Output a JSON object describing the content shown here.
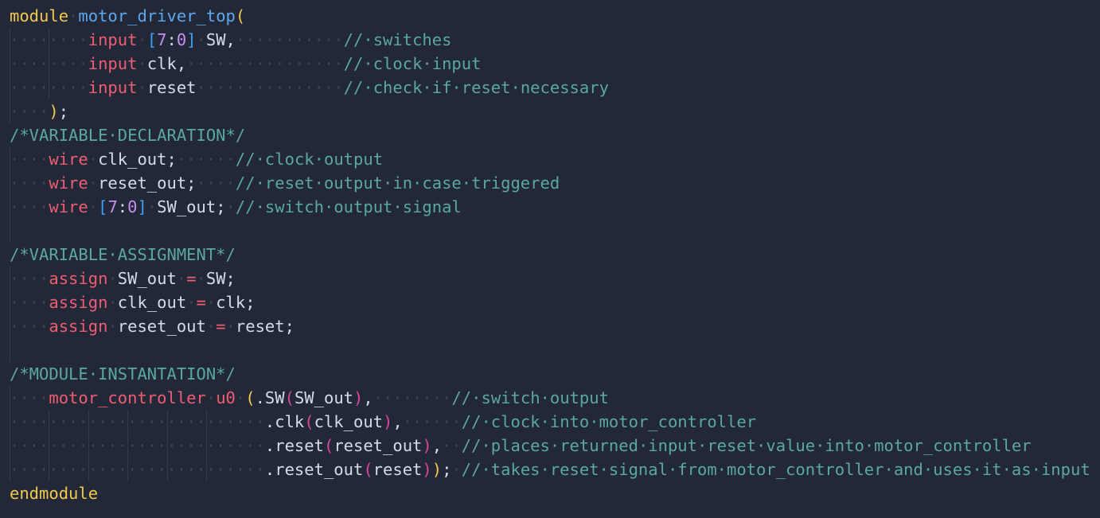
{
  "editor": {
    "background": "#222838",
    "indent_guide_color": "#343b4e",
    "whitespace_dot_color": "#3c4457",
    "colors": {
      "module": "#f2c94c",
      "name": "#5ea8ee",
      "kw": "#ee5d72",
      "id": "#d6dbe6",
      "num": "#c58ff0",
      "br1": "#f2c94c",
      "br2": "#d8479c",
      "br3": "#3d9ff5",
      "op": "#ee5d72",
      "punc": "#d6dbe6",
      "com": "#5ba8a0"
    },
    "lines": [
      {
        "guides": [],
        "tokens": [
          [
            "module",
            "module"
          ],
          [
            "ws",
            " "
          ],
          [
            "name",
            "motor_driver_top"
          ],
          [
            "br1",
            "("
          ]
        ]
      },
      {
        "guides": [
          0,
          4
        ],
        "tokens": [
          [
            "ws",
            "        "
          ],
          [
            "kw",
            "input"
          ],
          [
            "ws",
            " "
          ],
          [
            "br3",
            "["
          ],
          [
            "num",
            "7"
          ],
          [
            "punc",
            ":"
          ],
          [
            "num",
            "0"
          ],
          [
            "br3",
            "]"
          ],
          [
            "ws",
            " "
          ],
          [
            "id",
            "SW,"
          ],
          [
            "ws",
            "           "
          ],
          [
            "com",
            "// switches"
          ]
        ]
      },
      {
        "guides": [
          0,
          4
        ],
        "tokens": [
          [
            "ws",
            "        "
          ],
          [
            "kw",
            "input"
          ],
          [
            "ws",
            " "
          ],
          [
            "id",
            "clk,"
          ],
          [
            "ws",
            "                "
          ],
          [
            "com",
            "// clock input"
          ]
        ]
      },
      {
        "guides": [
          0,
          4
        ],
        "tokens": [
          [
            "ws",
            "        "
          ],
          [
            "kw",
            "input"
          ],
          [
            "ws",
            " "
          ],
          [
            "id",
            "reset"
          ],
          [
            "ws",
            "               "
          ],
          [
            "com",
            "// check if reset necessary"
          ]
        ]
      },
      {
        "guides": [
          0
        ],
        "tokens": [
          [
            "ws",
            "    "
          ],
          [
            "br1",
            ")"
          ],
          [
            "punc",
            ";"
          ]
        ]
      },
      {
        "guides": [],
        "tokens": [
          [
            "com",
            "/*VARIABLE DECLARATION*/"
          ]
        ]
      },
      {
        "guides": [
          0
        ],
        "tokens": [
          [
            "ws",
            "    "
          ],
          [
            "kw",
            "wire"
          ],
          [
            "ws",
            " "
          ],
          [
            "id",
            "clk_out;"
          ],
          [
            "ws",
            "      "
          ],
          [
            "com",
            "// clock output"
          ]
        ]
      },
      {
        "guides": [
          0
        ],
        "tokens": [
          [
            "ws",
            "    "
          ],
          [
            "kw",
            "wire"
          ],
          [
            "ws",
            " "
          ],
          [
            "id",
            "reset_out;"
          ],
          [
            "ws",
            "    "
          ],
          [
            "com",
            "// reset output in case triggered"
          ]
        ]
      },
      {
        "guides": [
          0
        ],
        "tokens": [
          [
            "ws",
            "    "
          ],
          [
            "kw",
            "wire"
          ],
          [
            "ws",
            " "
          ],
          [
            "br3",
            "["
          ],
          [
            "num",
            "7"
          ],
          [
            "punc",
            ":"
          ],
          [
            "num",
            "0"
          ],
          [
            "br3",
            "]"
          ],
          [
            "ws",
            " "
          ],
          [
            "id",
            "SW_out;"
          ],
          [
            "ws",
            " "
          ],
          [
            "com",
            "// switch output signal"
          ]
        ]
      },
      {
        "guides": [
          0
        ],
        "tokens": []
      },
      {
        "guides": [],
        "tokens": [
          [
            "com",
            "/*VARIABLE ASSIGNMENT*/"
          ]
        ]
      },
      {
        "guides": [
          0
        ],
        "tokens": [
          [
            "ws",
            "    "
          ],
          [
            "kw",
            "assign"
          ],
          [
            "ws",
            " "
          ],
          [
            "id",
            "SW_out"
          ],
          [
            "ws",
            " "
          ],
          [
            "op",
            "="
          ],
          [
            "ws",
            " "
          ],
          [
            "id",
            "SW;"
          ]
        ]
      },
      {
        "guides": [
          0
        ],
        "tokens": [
          [
            "ws",
            "    "
          ],
          [
            "kw",
            "assign"
          ],
          [
            "ws",
            " "
          ],
          [
            "id",
            "clk_out"
          ],
          [
            "ws",
            " "
          ],
          [
            "op",
            "="
          ],
          [
            "ws",
            " "
          ],
          [
            "id",
            "clk;"
          ]
        ]
      },
      {
        "guides": [
          0
        ],
        "tokens": [
          [
            "ws",
            "    "
          ],
          [
            "kw",
            "assign"
          ],
          [
            "ws",
            " "
          ],
          [
            "id",
            "reset_out"
          ],
          [
            "ws",
            " "
          ],
          [
            "op",
            "="
          ],
          [
            "ws",
            " "
          ],
          [
            "id",
            "reset;"
          ]
        ]
      },
      {
        "guides": [
          0
        ],
        "tokens": []
      },
      {
        "guides": [],
        "tokens": [
          [
            "com",
            "/*MODULE INSTANTATION*/"
          ]
        ]
      },
      {
        "guides": [
          0
        ],
        "tokens": [
          [
            "ws",
            "    "
          ],
          [
            "kw",
            "motor_controller"
          ],
          [
            "ws",
            " "
          ],
          [
            "kw",
            "u0"
          ],
          [
            "ws",
            " "
          ],
          [
            "br1",
            "("
          ],
          [
            "id",
            ".SW"
          ],
          [
            "br2",
            "("
          ],
          [
            "id",
            "SW_out"
          ],
          [
            "br2",
            ")"
          ],
          [
            "punc",
            ","
          ],
          [
            "ws",
            "        "
          ],
          [
            "com",
            "// switch output"
          ]
        ]
      },
      {
        "guides": [
          0,
          4,
          8,
          12,
          16,
          20
        ],
        "tokens": [
          [
            "ws",
            "                          "
          ],
          [
            "id",
            ".clk"
          ],
          [
            "br2",
            "("
          ],
          [
            "id",
            "clk_out"
          ],
          [
            "br2",
            ")"
          ],
          [
            "punc",
            ","
          ],
          [
            "ws",
            "      "
          ],
          [
            "com",
            "// clock into motor_controller"
          ]
        ]
      },
      {
        "guides": [
          0,
          4,
          8,
          12,
          16,
          20
        ],
        "tokens": [
          [
            "ws",
            "                          "
          ],
          [
            "id",
            ".reset"
          ],
          [
            "br2",
            "("
          ],
          [
            "id",
            "reset_out"
          ],
          [
            "br2",
            ")"
          ],
          [
            "punc",
            ","
          ],
          [
            "ws",
            "  "
          ],
          [
            "com",
            "// places returned input reset value into motor_controller"
          ]
        ]
      },
      {
        "guides": [
          0,
          4,
          8,
          12,
          16,
          20
        ],
        "tokens": [
          [
            "ws",
            "                          "
          ],
          [
            "id",
            ".reset_out"
          ],
          [
            "br2",
            "("
          ],
          [
            "id",
            "reset"
          ],
          [
            "br2",
            ")"
          ],
          [
            "br1",
            ")"
          ],
          [
            "punc",
            ";"
          ],
          [
            "ws",
            " "
          ],
          [
            "com",
            "// takes reset signal from motor_controller and uses it as input"
          ]
        ]
      },
      {
        "guides": [],
        "tokens": [
          [
            "module",
            "endmodule"
          ]
        ]
      }
    ]
  }
}
